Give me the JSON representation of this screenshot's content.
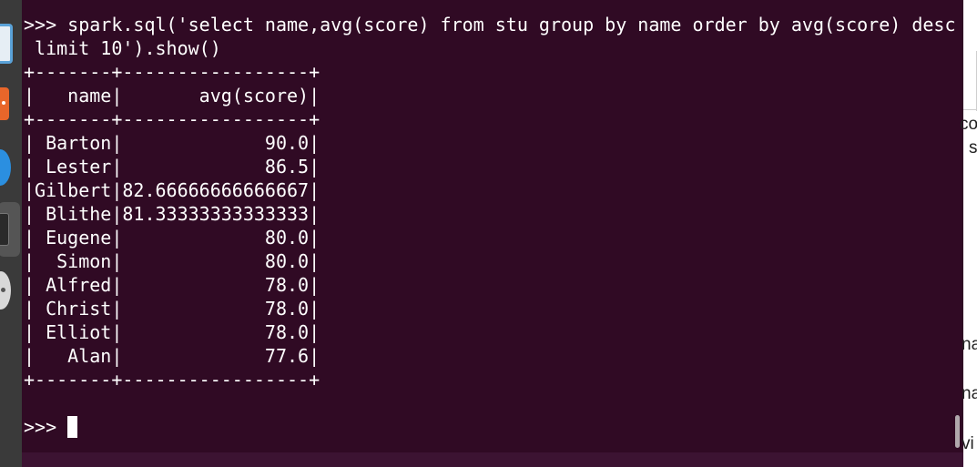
{
  "terminal": {
    "lines": [
      ">>> spark.sql('select name,avg(score) from stu group by name order by avg(score) desc",
      " limit 10').show()",
      "+-------+-----------------+",
      "|   name|       avg(score)|",
      "+-------+-----------------+",
      "| Barton|             90.0|",
      "| Lester|             86.5|",
      "|Gilbert|82.66666666666667|",
      "| Blithe|81.33333333333333|",
      "| Eugene|             80.0|",
      "|  Simon|             80.0|",
      "| Alfred|             78.0|",
      "| Christ|             78.0|",
      "| Elliot|             78.0|",
      "|   Alan|             77.6|",
      "+-------+-----------------+",
      "",
      ">>> "
    ]
  },
  "right_window": {
    "fragments": [
      "co",
      "s",
      "na",
      "na",
      "vi"
    ]
  }
}
